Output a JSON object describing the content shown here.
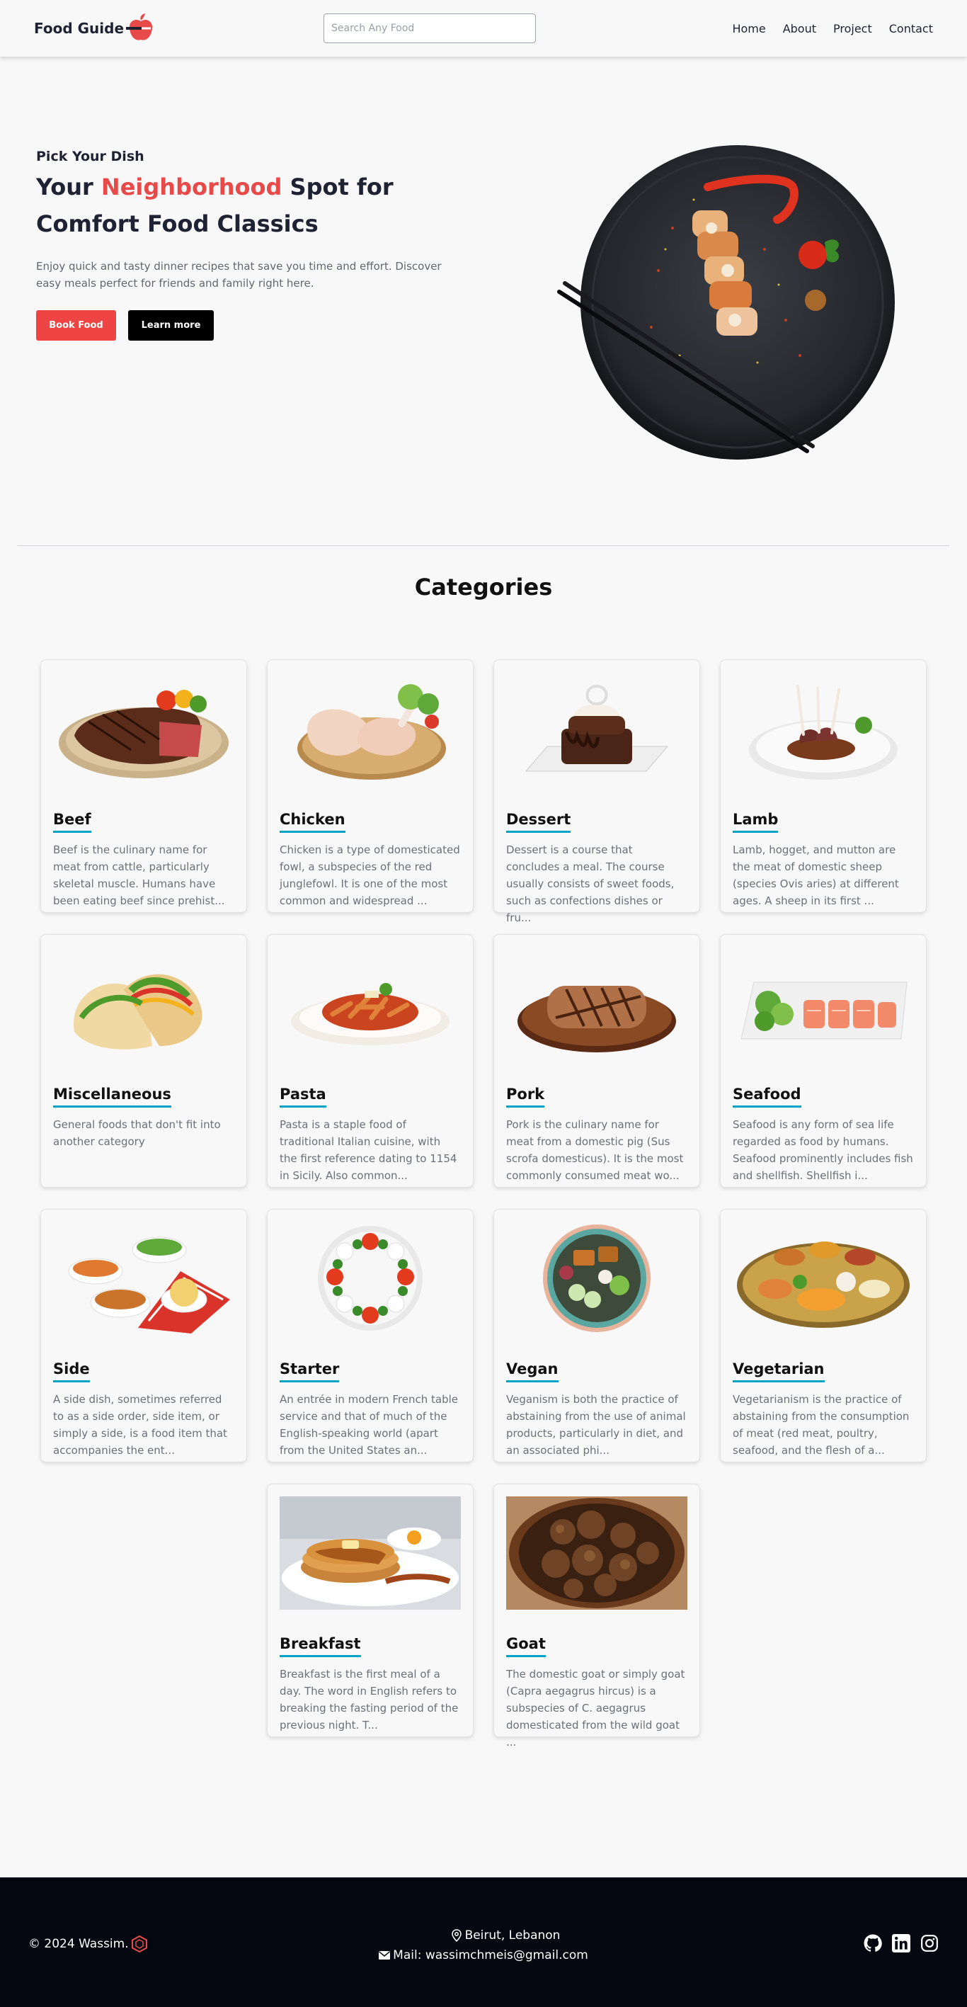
{
  "navbar": {
    "brand": "Food Guide",
    "search_placeholder": "Search Any Food",
    "links": [
      "Home",
      "About",
      "Project",
      "Contact"
    ]
  },
  "hero": {
    "kicker": "Pick Your Dish",
    "title_before": "Your ",
    "title_accent": "Neighborhood",
    "title_after": " Spot for Comfort Food Classics",
    "description": "Enjoy quick and tasty dinner recipes that save you time and effort. Discover easy meals perfect for friends and family right here.",
    "primary_button": "Book Food",
    "secondary_button": "Learn more"
  },
  "categories": {
    "heading": "Categories",
    "items": [
      {
        "name": "Beef",
        "description": "Beef is the culinary name for meat from cattle, particularly skeletal muscle. Humans have been eating beef since prehist...",
        "icon": "beef-steak"
      },
      {
        "name": "Chicken",
        "description": "Chicken is a type of domesticated fowl, a subspecies of the red junglefowl. It is one of the most common and widespread ...",
        "icon": "chicken-legs"
      },
      {
        "name": "Dessert",
        "description": "Dessert is a course that concludes a meal. The course usually consists of sweet foods, such as confections dishes or fru...",
        "icon": "chocolate-cake"
      },
      {
        "name": "Lamb",
        "description": "Lamb, hogget, and mutton are the meat of domestic sheep (species Ovis aries) at different ages.  A sheep in its first ...",
        "icon": "lamb-chops"
      },
      {
        "name": "Miscellaneous",
        "description": "General foods that don't fit into another category",
        "icon": "tacos"
      },
      {
        "name": "Pasta",
        "description": "Pasta is a staple food of traditional Italian cuisine, with the first reference dating to 1154 in Sicily.  Also common...",
        "icon": "pasta-bowl"
      },
      {
        "name": "Pork",
        "description": "Pork is the culinary name for meat from a domestic pig (Sus scrofa domesticus). It is the most commonly consumed meat wo...",
        "icon": "pork-chop"
      },
      {
        "name": "Seafood",
        "description": "Seafood is any form of sea life regarded as food by humans. Seafood prominently includes fish and shellfish. Shellfish i...",
        "icon": "salmon-plate"
      },
      {
        "name": "Side",
        "description": "A side dish, sometimes referred to as a side order, side item, or simply a side, is a food item that accompanies the ent...",
        "icon": "side-bowls"
      },
      {
        "name": "Starter",
        "description": "An entrée in modern French table service and that of much of the English-speaking world (apart from the United States an...",
        "icon": "caprese-plate"
      },
      {
        "name": "Vegan",
        "description": "Veganism is both the practice of abstaining from the use of animal products, particularly in diet, and an associated phi...",
        "icon": "vegan-bowl"
      },
      {
        "name": "Vegetarian",
        "description": "Vegetarianism is the practice of abstaining from the consumption of meat (red meat, poultry, seafood, and the flesh of a...",
        "icon": "thali-platter"
      },
      {
        "name": "Breakfast",
        "description": "Breakfast is the first meal of a day. The word in English refers to breaking the fasting period of the previous night. T...",
        "icon": "pancakes-eggs"
      },
      {
        "name": "Goat",
        "description": "The domestic goat or simply goat (Capra aegagrus hircus) is a subspecies of C. aegagrus domesticated from the wild goat ...",
        "icon": "goat-stew"
      }
    ]
  },
  "footer": {
    "copyright": "© 2024 Wassim.",
    "location": "Beirut, Lebanon",
    "email": "Mail: wassimchmeis@gmail.com",
    "socials": [
      "github",
      "linkedin",
      "instagram"
    ]
  },
  "colors": {
    "accent_red": "#e84a4a",
    "button_red": "#ef4444",
    "title_underline": "#00a3c8",
    "footer_bg": "#050810"
  }
}
